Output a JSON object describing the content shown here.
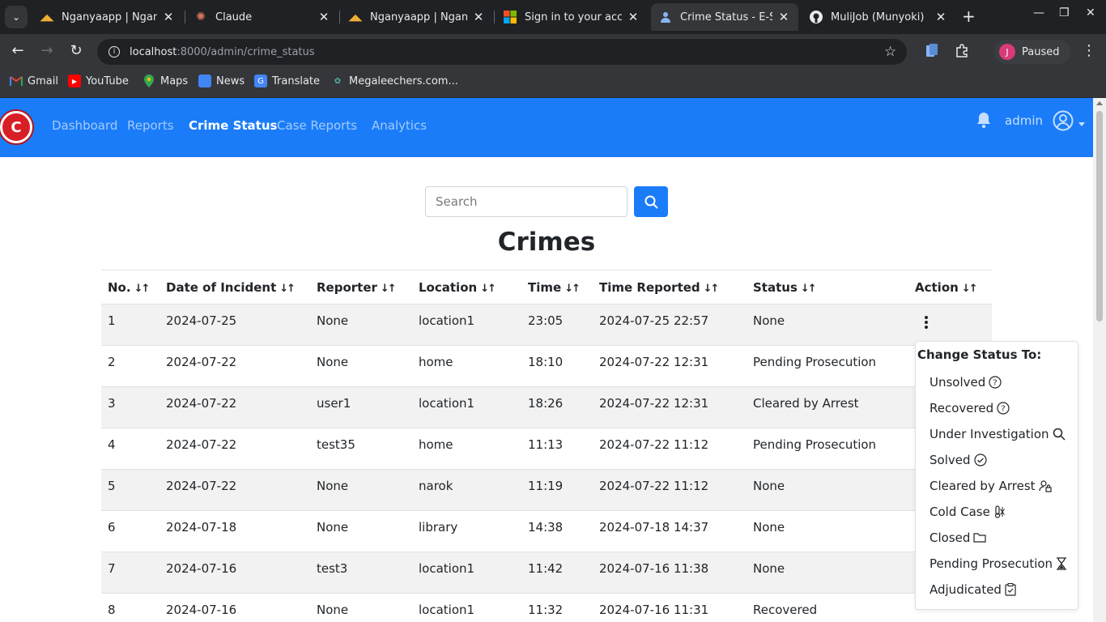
{
  "browser": {
    "tabs": [
      {
        "title": "Nganyaapp | Nganya",
        "icon": "nganya-favicon"
      },
      {
        "title": "Claude",
        "icon": "claude-favicon"
      },
      {
        "title": "Nganyaapp | Nganya",
        "icon": "nganya-favicon"
      },
      {
        "title": "Sign in to your acco",
        "icon": "microsoft-favicon"
      },
      {
        "title": "Crime Status - E-Se",
        "icon": "crime-favicon",
        "active": true
      },
      {
        "title": "MuliJob (Munyoki)",
        "icon": "github-favicon"
      }
    ],
    "url_host": "localhost",
    "url_path": ":8000/admin/crime_status",
    "profile_initial": "J",
    "profile_status": "Paused",
    "bookmarks": [
      "Gmail",
      "YouTube",
      "Maps",
      "News",
      "Translate",
      "Megaleechers.com..."
    ]
  },
  "nav": {
    "links": [
      "Dashboard",
      "Reports",
      "Crime Status",
      "Case Reports",
      "Analytics"
    ],
    "active": "Crime Status",
    "user": "admin",
    "brand_color": "#1a7cf8",
    "logo_letter": "C"
  },
  "search": {
    "placeholder": "Search"
  },
  "heading": "Crimes",
  "table": {
    "columns": [
      "No.",
      "Date of Incident",
      "Reporter",
      "Location",
      "Time",
      "Time Reported",
      "Status",
      "Action"
    ],
    "rows": [
      [
        "1",
        "2024-07-25",
        "None",
        "location1",
        "23:05",
        "2024-07-25 22:57",
        "None"
      ],
      [
        "2",
        "2024-07-22",
        "None",
        "home",
        "18:10",
        "2024-07-22 12:31",
        "Pending Prosecution"
      ],
      [
        "3",
        "2024-07-22",
        "user1",
        "location1",
        "18:26",
        "2024-07-22 12:31",
        "Cleared by Arrest"
      ],
      [
        "4",
        "2024-07-22",
        "test35",
        "home",
        "11:13",
        "2024-07-22 11:12",
        "Pending Prosecution"
      ],
      [
        "5",
        "2024-07-22",
        "None",
        "narok",
        "11:19",
        "2024-07-22 11:12",
        "None"
      ],
      [
        "6",
        "2024-07-18",
        "None",
        "library",
        "14:38",
        "2024-07-18 14:37",
        "None"
      ],
      [
        "7",
        "2024-07-16",
        "test3",
        "location1",
        "11:42",
        "2024-07-16 11:38",
        "None"
      ],
      [
        "8",
        "2024-07-16",
        "None",
        "location1",
        "11:32",
        "2024-07-16 11:31",
        "Recovered"
      ]
    ]
  },
  "dropdown": {
    "header": "Change Status To:",
    "items": [
      {
        "label": "Unsolved",
        "icon": "question-circle-icon"
      },
      {
        "label": "Recovered",
        "icon": "question-circle-icon"
      },
      {
        "label": "Under Investigation",
        "icon": "search-icon"
      },
      {
        "label": "Solved",
        "icon": "check-circle-icon"
      },
      {
        "label": "Cleared by Arrest",
        "icon": "person-lock-icon"
      },
      {
        "label": "Cold Case",
        "icon": "thermometer-snow-icon"
      },
      {
        "label": "Closed",
        "icon": "folder-icon"
      },
      {
        "label": "Pending Prosecution",
        "icon": "hourglass-icon"
      },
      {
        "label": "Adjudicated",
        "icon": "clipboard-check-icon"
      }
    ]
  }
}
